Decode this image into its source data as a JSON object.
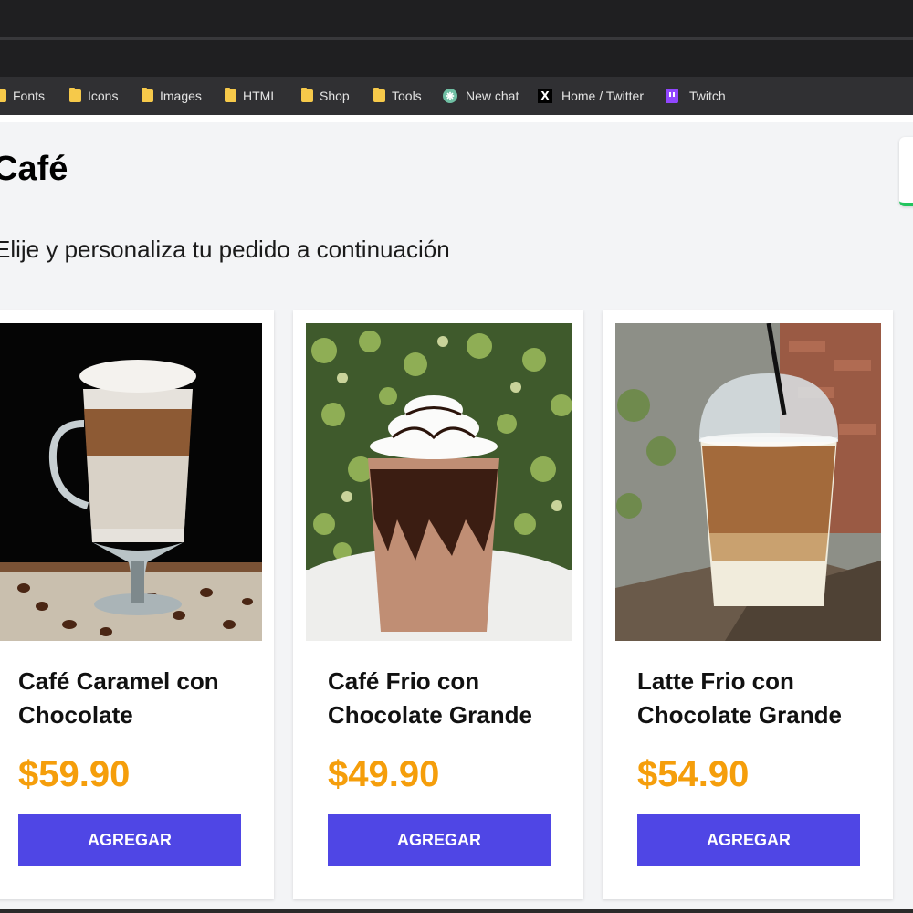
{
  "bookmarks": [
    {
      "label": "Fonts",
      "icon": "folder-icon"
    },
    {
      "label": "Icons",
      "icon": "folder-icon"
    },
    {
      "label": "Images",
      "icon": "folder-icon"
    },
    {
      "label": "HTML",
      "icon": "folder-icon"
    },
    {
      "label": "Shop",
      "icon": "folder-icon"
    },
    {
      "label": "Tools",
      "icon": "folder-icon"
    },
    {
      "label": "New chat",
      "icon": "chatgpt-icon"
    },
    {
      "label": "Home / Twitter",
      "icon": "x-icon"
    },
    {
      "label": "Twitch",
      "icon": "twitch-icon"
    }
  ],
  "page": {
    "title": "Café",
    "subtitle": "Elije y personaliza tu pedido a continuación"
  },
  "products": [
    {
      "name": "Café Caramel con Chocolate",
      "price": "$59.90",
      "button": "AGREGAR",
      "image": "caramel-chocolate-coffee-image"
    },
    {
      "name": "Café Frio con Chocolate Grande",
      "price": "$49.90",
      "button": "AGREGAR",
      "image": "iced-chocolate-coffee-image"
    },
    {
      "name": "Latte Frio con Chocolate Grande",
      "price": "$54.90",
      "button": "AGREGAR",
      "image": "iced-latte-image"
    }
  ],
  "colors": {
    "accent": "#4f46e5",
    "price": "#f59e0b",
    "background": "#f3f4f6"
  }
}
